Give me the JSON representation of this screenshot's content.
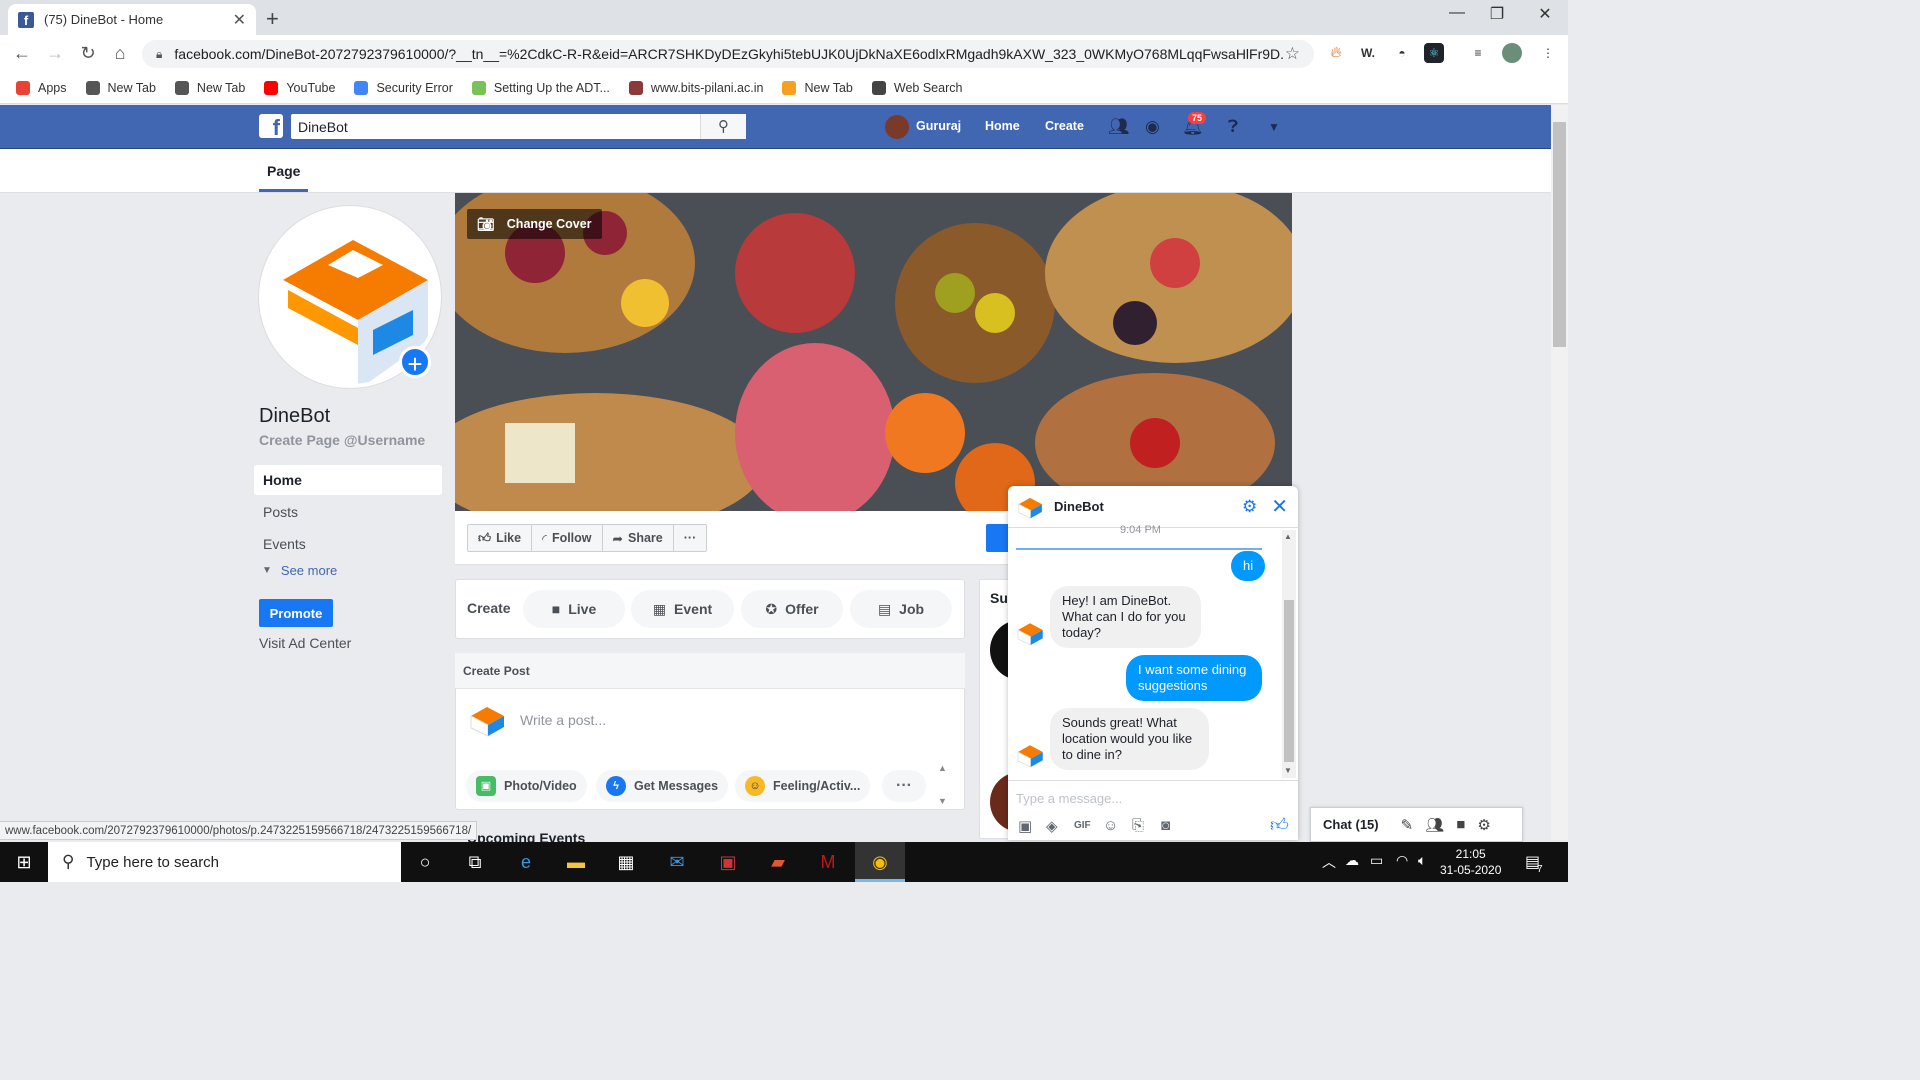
{
  "browser": {
    "tab_title": "(75) DineBot - Home",
    "tab_favicon": "f",
    "url": "facebook.com/DineBot-2072792379610000/?__tn__=%2CdkC-R-R&eid=ARCR7SHKDyDEzGkyhi5tebUJK0UjDkNaXE6odlxRMgadh9kAXW_323_0WKMyO768MLqqFwsaHlFr9D...",
    "bookmarks": [
      {
        "label": "Apps",
        "icon": "apps-icon",
        "color": "#e94235"
      },
      {
        "label": "New Tab",
        "icon": "globe-icon",
        "color": "#555555"
      },
      {
        "label": "New Tab",
        "icon": "globe-icon",
        "color": "#555555"
      },
      {
        "label": "YouTube",
        "icon": "youtube-icon",
        "color": "#ff0000"
      },
      {
        "label": "Security Error",
        "icon": "google-icon",
        "color": "#4285f4"
      },
      {
        "label": "Setting Up the ADT...",
        "icon": "android-icon",
        "color": "#78c257"
      },
      {
        "label": "www.bits-pilani.ac.in",
        "icon": "bits-icon",
        "color": "#8b3a3a"
      },
      {
        "label": "New Tab",
        "icon": "search-icon",
        "color": "#f4a020"
      },
      {
        "label": "Web Search",
        "icon": "web-search-icon",
        "color": "#444444"
      }
    ],
    "status_url": "www.facebook.com/2072792379610000/photos/p.2473225159566718/2473225159566718/"
  },
  "fb": {
    "search_value": "DineBot",
    "user_name": "Gururaj",
    "nav_home": "Home",
    "nav_create": "Create",
    "notif_count": "75",
    "page_tab": "Page",
    "brand_color": "#4267b2"
  },
  "page": {
    "name": "DineBot",
    "username_prompt": "Create Page @Username",
    "left_nav": [
      "Home",
      "Posts",
      "Events"
    ],
    "see_more": "See more",
    "promote": "Promote",
    "visit_ad_center": "Visit Ad Center",
    "change_cover": "Change Cover",
    "actions": [
      "Like",
      "Follow",
      "Share"
    ],
    "create_label": "Create",
    "create_items": [
      "Live",
      "Event",
      "Offer",
      "Job"
    ],
    "create_post_header": "Create Post",
    "post_placeholder": "Write a post...",
    "post_chips": [
      "Photo/Video",
      "Get Messages",
      "Feeling/Activ..."
    ],
    "upcoming": "Upcoming Events",
    "suggest_stub": "Su"
  },
  "chat": {
    "title": "DineBot",
    "time": "9:04 PM",
    "messages": [
      {
        "from": "me",
        "text": "hi"
      },
      {
        "from": "bot",
        "text": "Hey! I am DineBot. What can I do for you today?"
      },
      {
        "from": "me",
        "text": "I want some dining suggestions"
      },
      {
        "from": "bot",
        "text": "Sounds great! What location would you like to dine in?"
      }
    ],
    "input_placeholder": "Type a message...",
    "accent": "#0099ff"
  },
  "chatbar": {
    "label": "Chat (15)"
  },
  "taskbar": {
    "search_placeholder": "Type here to search",
    "time": "21:05",
    "date": "31-05-2020",
    "notif_count": "7"
  }
}
